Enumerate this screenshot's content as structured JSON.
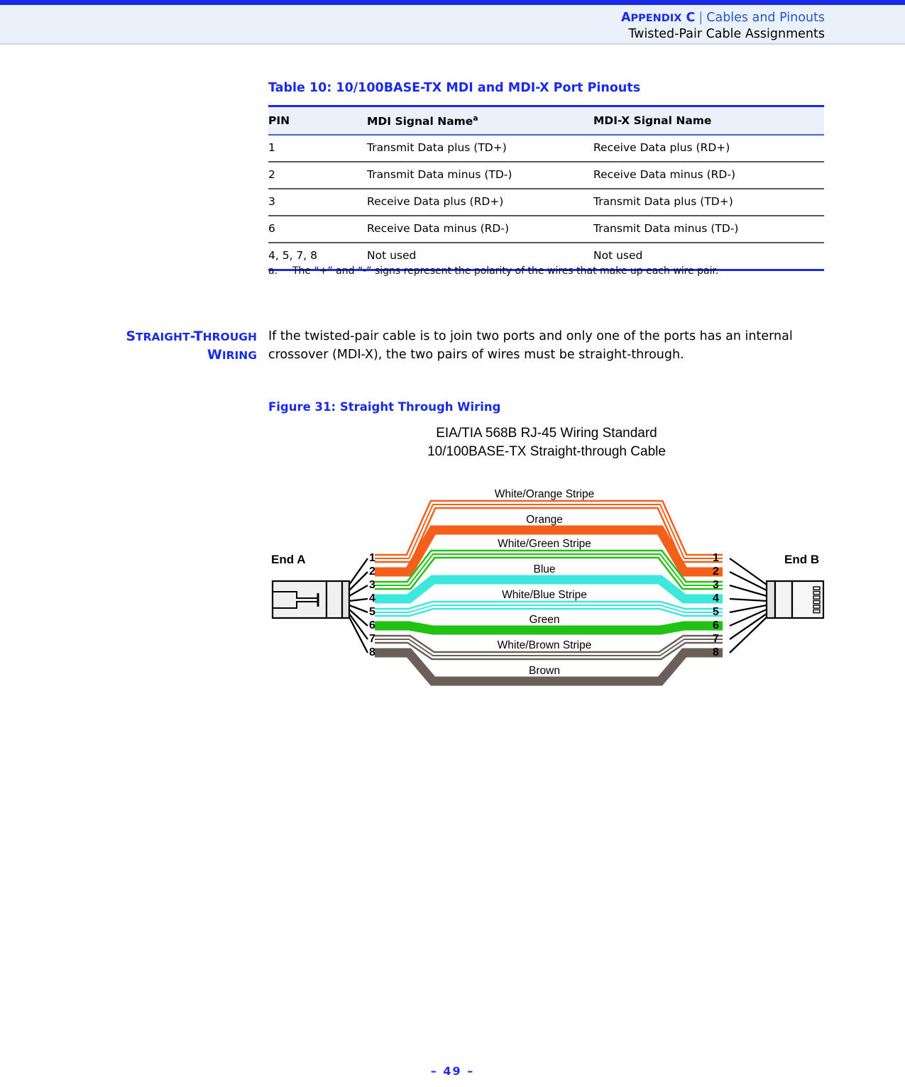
{
  "header": {
    "appendix_label": "APPENDIX C",
    "appendix_main": "A",
    "appendix_rest": "PPENDIX",
    "appendix_letter": "C",
    "separator": "|",
    "section": "Cables and Pinouts",
    "subtitle": "Twisted-Pair Cable Assignments"
  },
  "table": {
    "title": "Table 10: 10/100BASE-TX MDI and MDI-X Port Pinouts",
    "columns": [
      "PIN",
      "MDI Signal Name",
      "MDI-X Signal Name"
    ],
    "col2_footnote_marker": "a",
    "rows": [
      {
        "pin": "1",
        "mdi": "Transmit Data plus (TD+)",
        "mdix": "Receive Data plus (RD+)"
      },
      {
        "pin": "2",
        "mdi": "Transmit Data minus (TD-)",
        "mdix": "Receive Data minus (RD-)"
      },
      {
        "pin": "3",
        "mdi": "Receive Data plus (RD+)",
        "mdix": "Transmit Data plus (TD+)"
      },
      {
        "pin": "6",
        "mdi": "Receive Data minus (RD-)",
        "mdix": "Transmit Data minus (TD-)"
      },
      {
        "pin": "4, 5, 7, 8",
        "mdi": "Not used",
        "mdix": "Not used"
      }
    ],
    "footnote_marker": "a.",
    "footnote_text": "The “+” and “-” signs represent the polarity of the wires that make up each wire pair."
  },
  "section": {
    "heading_line1_cap": "S",
    "heading_line1_rest": "TRAIGHT",
    "heading_line1_dash": "-T",
    "heading_line1_rest2": "HROUGH",
    "heading_line2_cap": "W",
    "heading_line2_rest": "IRING",
    "heading_plain": "STRAIGHT-THROUGH WIRING",
    "body": "If the twisted-pair cable is to join two ports and only one of the ports has an internal crossover (MDI-X), the two pairs of wires must be straight-through."
  },
  "figure": {
    "caption": "Figure 31:  Straight Through Wiring",
    "title_line1": "EIA/TIA 568B RJ-45 Wiring Standard",
    "title_line2": "10/100BASE-TX Straight-through Cable",
    "end_a_label": "End A",
    "end_b_label": "End B",
    "pin_numbers": [
      "1",
      "2",
      "3",
      "4",
      "5",
      "6",
      "7",
      "8"
    ],
    "wires": [
      {
        "pin": "1",
        "label": "White/Orange Stripe",
        "color": "#F4601A",
        "style": "stripe"
      },
      {
        "pin": "2",
        "label": "Orange",
        "color": "#F4601A",
        "style": "solid"
      },
      {
        "pin": "3",
        "label": "White/Green Stripe",
        "color": "#22C213",
        "style": "stripe"
      },
      {
        "pin": "4",
        "label": "Blue",
        "color": "#3CE8DC",
        "style": "solid"
      },
      {
        "pin": "5",
        "label": "White/Blue Stripe",
        "color": "#3CE8DC",
        "style": "stripe"
      },
      {
        "pin": "6",
        "label": "Green",
        "color": "#22C213",
        "style": "solid"
      },
      {
        "pin": "7",
        "label": "White/Brown Stripe",
        "color": "#6B6059",
        "style": "stripe"
      },
      {
        "pin": "8",
        "label": "Brown",
        "color": "#6B6059",
        "style": "solid"
      }
    ]
  },
  "footer": {
    "page": "–  49  –"
  },
  "colors": {
    "accent_blue": "#1a2be8",
    "header_band": "#eaf1fb",
    "orange": "#F4601A",
    "green": "#22C213",
    "cyan": "#3CE8DC",
    "brown": "#6B6059"
  }
}
